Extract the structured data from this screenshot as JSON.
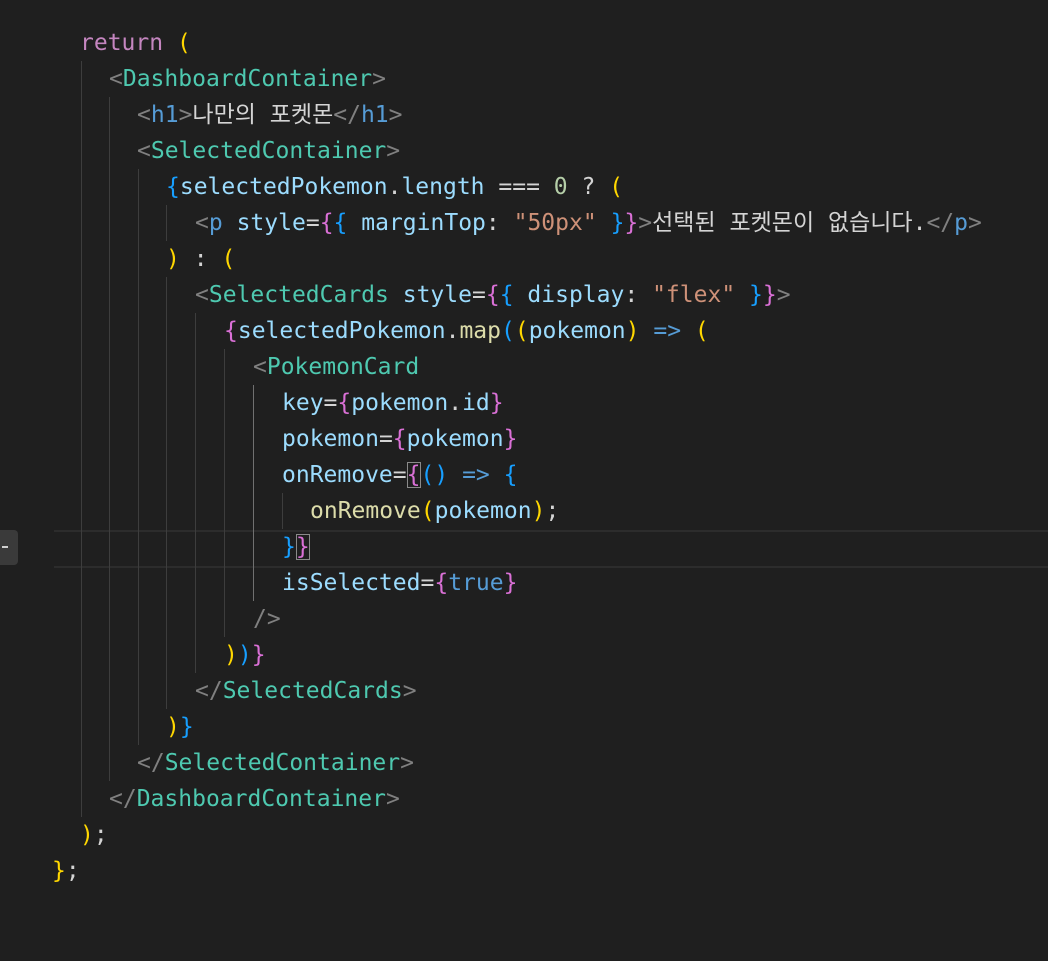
{
  "editor": {
    "language": "jsx",
    "active_line": 15,
    "text": {
      "return_kw": "return",
      "dashboard_container": "DashboardContainer",
      "h1": "h1",
      "h1_text": "나만의 포켓몬",
      "selected_container": "SelectedContainer",
      "selected_pokemon": "selectedPokemon",
      "length": "length",
      "strict_eq": "===",
      "zero": "0",
      "p": "p",
      "style": "style",
      "margin_top": "marginTop",
      "margin_value": "\"50px\"",
      "empty_text": "선택된 포켓몬이 없습니다.",
      "selected_cards": "SelectedCards",
      "display": "display",
      "flex_value": "\"flex\"",
      "map": "map",
      "pokemon": "pokemon",
      "arrow": "=>",
      "pokemon_card": "PokemonCard",
      "key": "key",
      "id": "id",
      "on_remove": "onRemove",
      "is_selected": "isSelected",
      "true_kw": "true"
    }
  }
}
